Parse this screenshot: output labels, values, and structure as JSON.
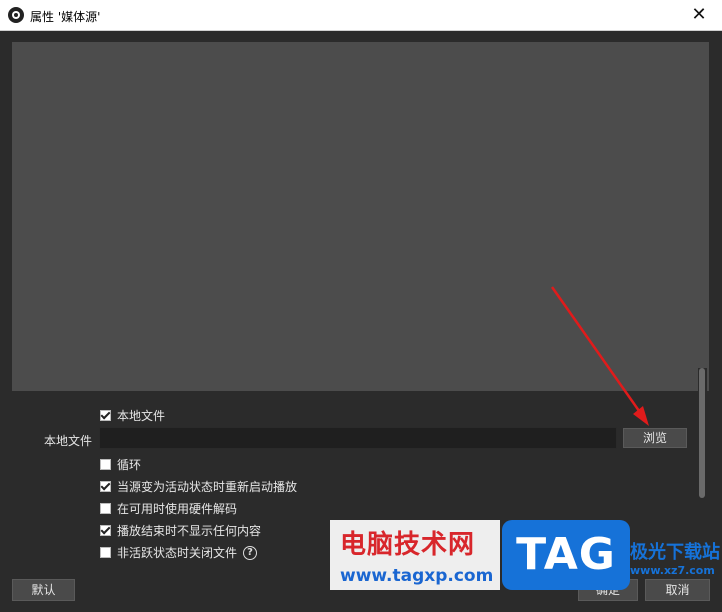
{
  "window": {
    "title": "属性 '媒体源'",
    "close_glyph": "✕"
  },
  "properties": {
    "local_file_checkbox": {
      "label": "本地文件",
      "checked": true
    },
    "local_file_field": {
      "label": "本地文件",
      "value": ""
    },
    "browse_button": "浏览",
    "options": [
      {
        "label": "循环",
        "checked": false
      },
      {
        "label": "当源变为活动状态时重新启动播放",
        "checked": true
      },
      {
        "label": "在可用时使用硬件解码",
        "checked": false
      },
      {
        "label": "播放结束时不显示任何内容",
        "checked": true
      },
      {
        "label": "非活跃状态时关闭文件",
        "checked": false
      }
    ],
    "help_glyph": "?"
  },
  "footer": {
    "defaults_button": "默认",
    "ok_button": "确定",
    "cancel_button": "取消"
  },
  "watermark": {
    "site_name": "电脑技术网",
    "url": "www.tagxp.com",
    "tag": "TAG",
    "extra": "极光下载站",
    "extra_url": "www.xz7.com"
  },
  "colors": {
    "annotation_arrow": "#e01b1b",
    "preview_bg": "#4c4c4c",
    "window_bg": "#2b2b2b"
  }
}
